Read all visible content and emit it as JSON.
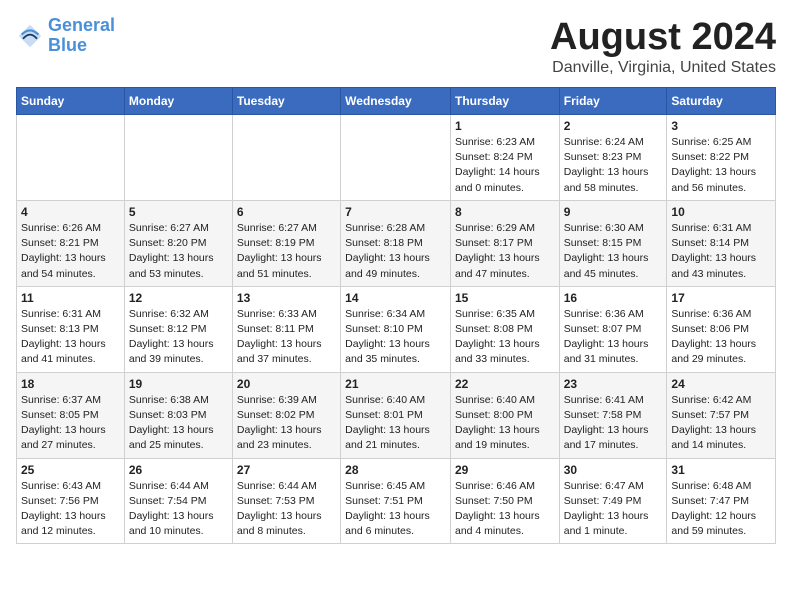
{
  "header": {
    "logo_line1": "General",
    "logo_line2": "Blue",
    "month_title": "August 2024",
    "location": "Danville, Virginia, United States"
  },
  "days_of_week": [
    "Sunday",
    "Monday",
    "Tuesday",
    "Wednesday",
    "Thursday",
    "Friday",
    "Saturday"
  ],
  "weeks": [
    [
      {
        "day": "",
        "content": ""
      },
      {
        "day": "",
        "content": ""
      },
      {
        "day": "",
        "content": ""
      },
      {
        "day": "",
        "content": ""
      },
      {
        "day": "1",
        "content": "Sunrise: 6:23 AM\nSunset: 8:24 PM\nDaylight: 14 hours\nand 0 minutes."
      },
      {
        "day": "2",
        "content": "Sunrise: 6:24 AM\nSunset: 8:23 PM\nDaylight: 13 hours\nand 58 minutes."
      },
      {
        "day": "3",
        "content": "Sunrise: 6:25 AM\nSunset: 8:22 PM\nDaylight: 13 hours\nand 56 minutes."
      }
    ],
    [
      {
        "day": "4",
        "content": "Sunrise: 6:26 AM\nSunset: 8:21 PM\nDaylight: 13 hours\nand 54 minutes."
      },
      {
        "day": "5",
        "content": "Sunrise: 6:27 AM\nSunset: 8:20 PM\nDaylight: 13 hours\nand 53 minutes."
      },
      {
        "day": "6",
        "content": "Sunrise: 6:27 AM\nSunset: 8:19 PM\nDaylight: 13 hours\nand 51 minutes."
      },
      {
        "day": "7",
        "content": "Sunrise: 6:28 AM\nSunset: 8:18 PM\nDaylight: 13 hours\nand 49 minutes."
      },
      {
        "day": "8",
        "content": "Sunrise: 6:29 AM\nSunset: 8:17 PM\nDaylight: 13 hours\nand 47 minutes."
      },
      {
        "day": "9",
        "content": "Sunrise: 6:30 AM\nSunset: 8:15 PM\nDaylight: 13 hours\nand 45 minutes."
      },
      {
        "day": "10",
        "content": "Sunrise: 6:31 AM\nSunset: 8:14 PM\nDaylight: 13 hours\nand 43 minutes."
      }
    ],
    [
      {
        "day": "11",
        "content": "Sunrise: 6:31 AM\nSunset: 8:13 PM\nDaylight: 13 hours\nand 41 minutes."
      },
      {
        "day": "12",
        "content": "Sunrise: 6:32 AM\nSunset: 8:12 PM\nDaylight: 13 hours\nand 39 minutes."
      },
      {
        "day": "13",
        "content": "Sunrise: 6:33 AM\nSunset: 8:11 PM\nDaylight: 13 hours\nand 37 minutes."
      },
      {
        "day": "14",
        "content": "Sunrise: 6:34 AM\nSunset: 8:10 PM\nDaylight: 13 hours\nand 35 minutes."
      },
      {
        "day": "15",
        "content": "Sunrise: 6:35 AM\nSunset: 8:08 PM\nDaylight: 13 hours\nand 33 minutes."
      },
      {
        "day": "16",
        "content": "Sunrise: 6:36 AM\nSunset: 8:07 PM\nDaylight: 13 hours\nand 31 minutes."
      },
      {
        "day": "17",
        "content": "Sunrise: 6:36 AM\nSunset: 8:06 PM\nDaylight: 13 hours\nand 29 minutes."
      }
    ],
    [
      {
        "day": "18",
        "content": "Sunrise: 6:37 AM\nSunset: 8:05 PM\nDaylight: 13 hours\nand 27 minutes."
      },
      {
        "day": "19",
        "content": "Sunrise: 6:38 AM\nSunset: 8:03 PM\nDaylight: 13 hours\nand 25 minutes."
      },
      {
        "day": "20",
        "content": "Sunrise: 6:39 AM\nSunset: 8:02 PM\nDaylight: 13 hours\nand 23 minutes."
      },
      {
        "day": "21",
        "content": "Sunrise: 6:40 AM\nSunset: 8:01 PM\nDaylight: 13 hours\nand 21 minutes."
      },
      {
        "day": "22",
        "content": "Sunrise: 6:40 AM\nSunset: 8:00 PM\nDaylight: 13 hours\nand 19 minutes."
      },
      {
        "day": "23",
        "content": "Sunrise: 6:41 AM\nSunset: 7:58 PM\nDaylight: 13 hours\nand 17 minutes."
      },
      {
        "day": "24",
        "content": "Sunrise: 6:42 AM\nSunset: 7:57 PM\nDaylight: 13 hours\nand 14 minutes."
      }
    ],
    [
      {
        "day": "25",
        "content": "Sunrise: 6:43 AM\nSunset: 7:56 PM\nDaylight: 13 hours\nand 12 minutes."
      },
      {
        "day": "26",
        "content": "Sunrise: 6:44 AM\nSunset: 7:54 PM\nDaylight: 13 hours\nand 10 minutes."
      },
      {
        "day": "27",
        "content": "Sunrise: 6:44 AM\nSunset: 7:53 PM\nDaylight: 13 hours\nand 8 minutes."
      },
      {
        "day": "28",
        "content": "Sunrise: 6:45 AM\nSunset: 7:51 PM\nDaylight: 13 hours\nand 6 minutes."
      },
      {
        "day": "29",
        "content": "Sunrise: 6:46 AM\nSunset: 7:50 PM\nDaylight: 13 hours\nand 4 minutes."
      },
      {
        "day": "30",
        "content": "Sunrise: 6:47 AM\nSunset: 7:49 PM\nDaylight: 13 hours\nand 1 minute."
      },
      {
        "day": "31",
        "content": "Sunrise: 6:48 AM\nSunset: 7:47 PM\nDaylight: 12 hours\nand 59 minutes."
      }
    ]
  ]
}
